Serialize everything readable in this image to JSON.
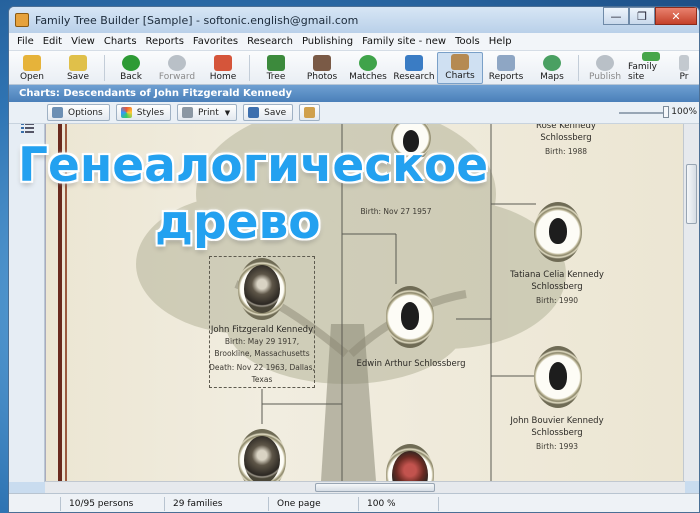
{
  "window": {
    "title": "Family Tree Builder [Sample] - softonic.english@gmail.com",
    "min_label": "—",
    "max_label": "❐",
    "close_label": "✕"
  },
  "menu": [
    "File",
    "Edit",
    "View",
    "Charts",
    "Reports",
    "Favorites",
    "Research",
    "Publishing",
    "Family site - new",
    "Tools",
    "Help"
  ],
  "toolbar": [
    {
      "label": "Open",
      "icon": "folder-open-icon",
      "color": "#e6b33a",
      "enabled": true
    },
    {
      "label": "Save",
      "icon": "save-icon",
      "color": "#e0c04a",
      "enabled": true
    },
    {
      "label": "Back",
      "icon": "back-arrow-icon",
      "color": "#2e9b35",
      "enabled": true
    },
    {
      "label": "Forward",
      "icon": "forward-arrow-icon",
      "color": "#b9c0c7",
      "enabled": false
    },
    {
      "label": "Home",
      "icon": "home-icon",
      "color": "#d5553a",
      "enabled": true
    },
    {
      "label": "Tree",
      "icon": "tree-icon",
      "color": "#3c8a3c",
      "enabled": true
    },
    {
      "label": "Photos",
      "icon": "photos-icon",
      "color": "#7a5a46",
      "enabled": true
    },
    {
      "label": "Matches",
      "icon": "matches-icon",
      "color": "#3fa34a",
      "enabled": true
    },
    {
      "label": "Research",
      "icon": "research-icon",
      "color": "#3a7cc4",
      "enabled": true
    },
    {
      "label": "Charts",
      "icon": "charts-icon",
      "color": "#b58a52",
      "enabled": true,
      "active": true
    },
    {
      "label": "Reports",
      "icon": "reports-icon",
      "color": "#8ea6c4",
      "enabled": true
    },
    {
      "label": "Maps",
      "icon": "maps-icon",
      "color": "#4aa062",
      "enabled": true
    },
    {
      "label": "Publish",
      "icon": "publish-icon",
      "color": "#b9c0c7",
      "enabled": false
    },
    {
      "label": "Family site",
      "icon": "family-site-icon",
      "color": "#47a64a",
      "enabled": true
    },
    {
      "label": "Pr",
      "icon": "print-icon",
      "color": "#c3c9cf",
      "enabled": true
    }
  ],
  "view_header": "Charts: Descendants of John Fitzgerald Kennedy",
  "chart_toolbar": {
    "options": "Options",
    "styles": "Styles",
    "print": "Print",
    "save": "Save",
    "zoom": "100%"
  },
  "overlay": {
    "line1": "Генеалогическое",
    "line2": "древо"
  },
  "people": {
    "p1": {
      "name_1": "Rose Kennedy",
      "name_2": "Schlossberg",
      "birth": "Birth: 1988"
    },
    "p2": {
      "birth": "Birth: Nov 27 1957"
    },
    "p3": {
      "name_1": "Tatiana Celia Kennedy",
      "name_2": "Schlossberg",
      "birth": "Birth: 1990"
    },
    "jfk": {
      "name": "John Fitzgerald Kennedy",
      "birth": "Birth: May 29 1917,",
      "birth_place": "Brookline, Massachusetts",
      "death": "Death: Nov 22 1963, Dallas,",
      "death_place": "Texas"
    },
    "edwin": {
      "name": "Edwin Arthur Schlossberg"
    },
    "john": {
      "name_1": "John Bouvier Kennedy",
      "name_2": "Schlossberg",
      "birth": "Birth: 1993"
    }
  },
  "status": {
    "persons": "10/95 persons",
    "families": "29 families",
    "pages": "One page",
    "zoom": "100 %"
  }
}
